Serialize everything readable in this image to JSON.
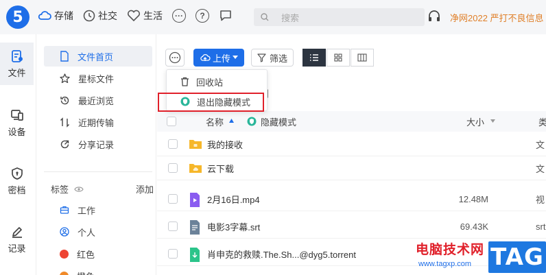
{
  "app": {
    "logo_text": "5"
  },
  "topnav": {
    "items": [
      {
        "label": "存储",
        "icon": "cloud-icon",
        "active": true
      },
      {
        "label": "社交",
        "icon": "clock-icon"
      },
      {
        "label": "生活",
        "icon": "heart-icon"
      }
    ],
    "search_placeholder": "搜索",
    "notice": "净网2022 严打不良信息"
  },
  "rail": [
    {
      "label": "文件",
      "icon": "file-icon",
      "active": true
    },
    {
      "label": "设备",
      "icon": "device-icon"
    },
    {
      "label": "密档",
      "icon": "shield-icon"
    },
    {
      "label": "记录",
      "icon": "pencil-icon"
    }
  ],
  "sidebar": {
    "items": [
      {
        "label": "文件首页",
        "icon": "file-outline-icon",
        "active": true
      },
      {
        "label": "星标文件",
        "icon": "star-icon"
      },
      {
        "label": "最近浏览",
        "icon": "history-icon"
      },
      {
        "label": "近期传输",
        "icon": "transfer-icon"
      },
      {
        "label": "分享记录",
        "icon": "share-icon"
      }
    ],
    "tags_label": "标签",
    "tags_add": "添加",
    "tags": [
      {
        "label": "工作",
        "icon": "briefcase-icon"
      },
      {
        "label": "个人",
        "icon": "person-icon"
      },
      {
        "label": "红色",
        "color": "#ee4433"
      },
      {
        "label": "橙色",
        "color": "#f08a2a"
      }
    ]
  },
  "toolbar": {
    "upload_label": "上传",
    "filter_label": "筛选"
  },
  "dropdown": {
    "items": [
      {
        "label": "回收站",
        "icon": "trash-icon"
      },
      {
        "label": "退出隐藏模式",
        "icon": "hidden-mode-icon"
      }
    ]
  },
  "path_tail": "]",
  "table": {
    "col_name": "名称",
    "col_hidden": "隐藏模式",
    "col_size": "大小",
    "col_type": "类",
    "rows": [
      {
        "name": "我的接收",
        "size": "",
        "type": "文",
        "icon": "folder-icon"
      },
      {
        "name": "云下载",
        "size": "",
        "type": "文",
        "icon": "cloud-folder-icon"
      },
      {
        "name": "2月16日.mp4",
        "size": "12.48M",
        "type": "视",
        "icon": "video-file-icon"
      },
      {
        "name": "电影3字幕.srt",
        "size": "69.43K",
        "type": "srt",
        "icon": "text-file-icon"
      },
      {
        "name": "肖申克的救赎.The.Sh...@dyg5.torrent",
        "size": "",
        "type": "",
        "icon": "torrent-file-icon"
      }
    ]
  },
  "watermark": {
    "title": "电脑技术网",
    "url": "www.tagxp.com",
    "tag": "TAG"
  }
}
